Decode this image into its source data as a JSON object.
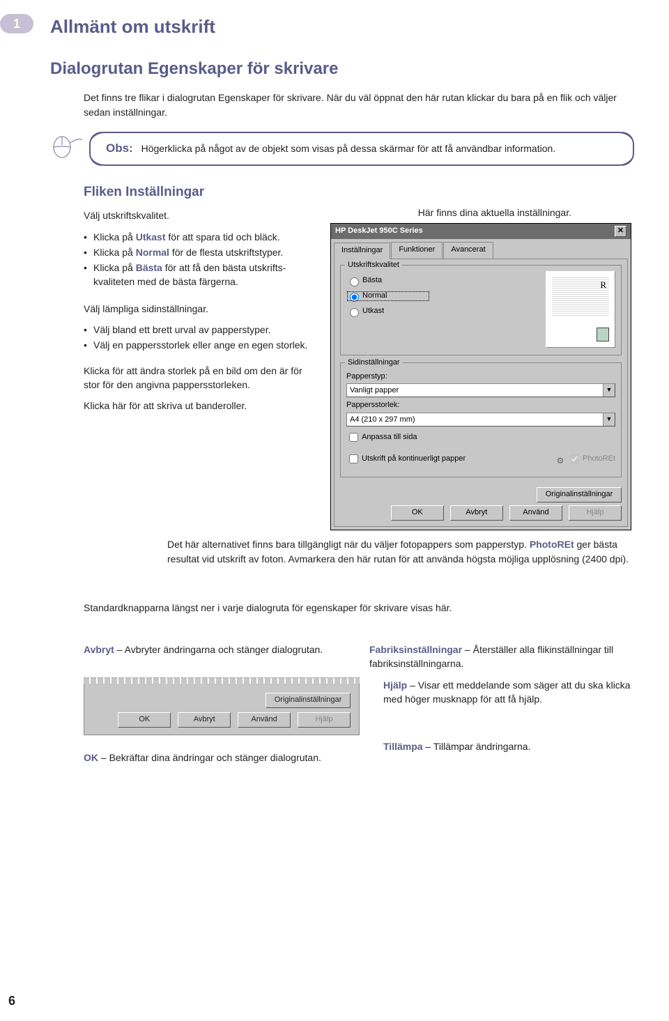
{
  "chapter": {
    "number": "1",
    "title": "Allmänt om utskrift"
  },
  "section": {
    "title": "Dialogrutan Egenskaper för skrivare"
  },
  "intro": "Det finns tre flikar i dialogrutan Egenskaper för skrivare. När du väl öppnat den här rutan klickar du bara på en flik och väljer sedan inställningar.",
  "note": {
    "label": "Obs:",
    "text": "Högerklicka på något av de objekt som visas på dessa skärmar för att få användbar information."
  },
  "settings": {
    "heading": "Fliken Inställningar",
    "quality_intro": "Välj utskriftskvalitet.",
    "quality_bullets": [
      {
        "pre": "Klicka på ",
        "term": "Utkast",
        "post": " för att spara tid och bläck."
      },
      {
        "pre": "Klicka på ",
        "term": "Normal",
        "post": " för de flesta utskriftstyper."
      },
      {
        "pre": "Klicka på ",
        "term": "Bästa",
        "post": " för att få den bästa utskrifts­kvaliteten med de bästa färgerna."
      }
    ],
    "page_intro": "Välj lämpliga sidinställningar.",
    "page_bullets": [
      "Välj bland ett brett urval av papperstyper.",
      "Välj en pappersstorlek eller ange en egen storlek."
    ],
    "scale_text": "Klicka för att ändra storlek på en bild om den är för stor för den angivna pappers­storleken.",
    "banner_text": "Klicka här för att skriva ut bande­roller.",
    "callout_right": "Här finns dina aktuella inställningar.",
    "photo_note_a": "Det här alternativet finns bara tillgängligt när du väljer fotopappers som papperstyp. ",
    "photo_note_term": "PhotoREt",
    "photo_note_b": " ger bästa resultat vid utskrift av foton. Avmarkera den här rutan för att använda högsta möjliga upplösning (2400 dpi)."
  },
  "dialog": {
    "title": "HP DeskJet 950C Series",
    "close": "✕",
    "tabs": {
      "t1": "Inställningar",
      "t2": "Funktioner",
      "t3": "Avancerat"
    },
    "group_quality": "Utskriftskvalitet",
    "radio_best": "Bästa",
    "radio_normal": "Normal",
    "radio_draft": "Utkast",
    "preview_mark": "R",
    "group_page": "Sidinställningar",
    "label_type": "Papperstyp:",
    "value_type": "Vanligt papper",
    "label_size": "Pappersstorlek:",
    "value_size": "A4 (210 x 297 mm)",
    "chk_fit": "Anpassa till sida",
    "chk_banner": "Utskrift på kontinuerligt papper",
    "chk_photoret": "PhotoREt",
    "btn_defaults": "Originalinställningar",
    "btn_ok": "OK",
    "btn_cancel": "Avbryt",
    "btn_apply": "Använd",
    "btn_help": "Hjälp"
  },
  "std_buttons_intro": "Standardknapparna längst ner i varje dialogruta för egenskaper för skrivare visas här.",
  "legend": {
    "cancel": {
      "term": "Avbryt",
      "text": " – Avbryter ändringarna och stänger dialogrutan."
    },
    "defaults": {
      "term": "Fabriksinställningar",
      "text": " – Återställer alla flik­inställningar till fabriksinställningarna."
    },
    "help": {
      "term": "Hjälp",
      "text": " – Visar ett meddelande som säger att du ska klicka med höger musknapp för att få hjälp."
    },
    "ok": {
      "term": "OK",
      "text": " – Bekräftar dina ändringar och stänger dialogrutan."
    },
    "apply": {
      "term": "Tillämpa",
      "text": " – Tillämpar ändringarna."
    }
  },
  "page_number": "6"
}
